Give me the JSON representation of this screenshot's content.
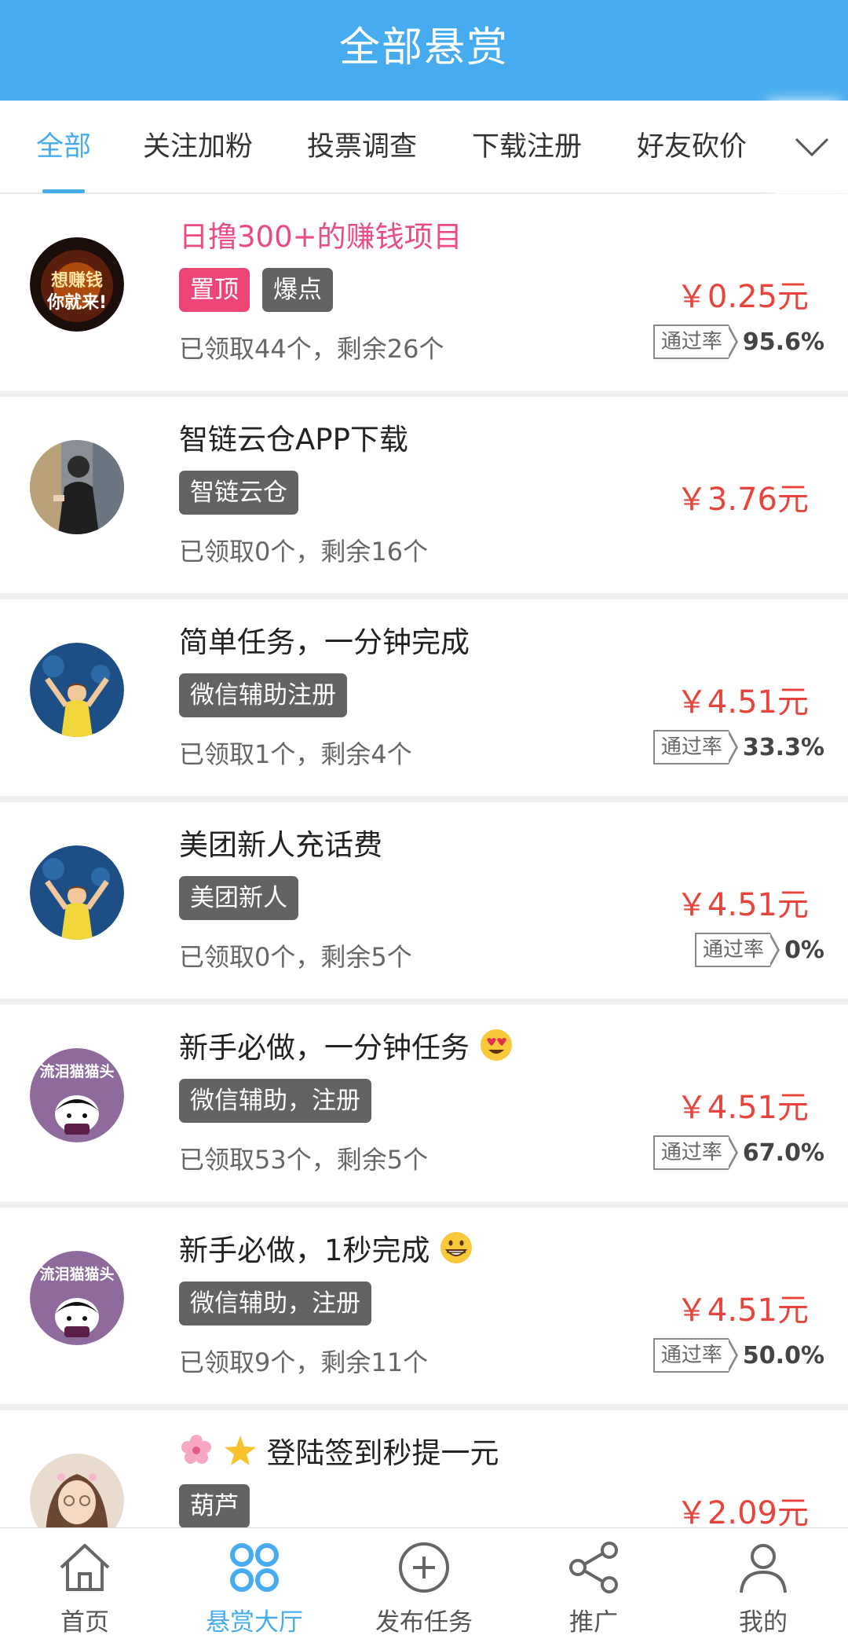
{
  "header": {
    "title": "全部悬赏"
  },
  "tabs": [
    {
      "label": "全部",
      "active": true
    },
    {
      "label": "关注加粉"
    },
    {
      "label": "投票调查"
    },
    {
      "label": "下载注册"
    },
    {
      "label": "好友砍价"
    }
  ],
  "more_icon": "chevron-down-icon",
  "items": [
    {
      "title": "日撸300+的赚钱项目",
      "hot": true,
      "tags": [
        "置顶",
        "爆点"
      ],
      "stats": "已领取44个，剩余26个",
      "price": "￥0.25元",
      "pass_label": "通过率",
      "pass_rate": "95.6%",
      "avatar_text": "想赚钱 你就来!"
    },
    {
      "title": "智链云仓APP下载",
      "tags": [
        "智链云仓"
      ],
      "stats": "已领取0个，剩余16个",
      "price": "￥3.76元"
    },
    {
      "title": "简单任务，一分钟完成",
      "tags": [
        "微信辅助注册"
      ],
      "stats": "已领取1个，剩余4个",
      "price": "￥4.51元",
      "pass_label": "通过率",
      "pass_rate": "33.3%"
    },
    {
      "title": "美团新人充话费",
      "tags": [
        "美团新人"
      ],
      "stats": "已领取0个，剩余5个",
      "price": "￥4.51元",
      "pass_label": "通过率",
      "pass_rate": "0%"
    },
    {
      "title": "新手必做，一分钟任务",
      "emoji": "heart-eyes-emoji",
      "tags": [
        "微信辅助，注册"
      ],
      "stats": "已领取53个，剩余5个",
      "price": "￥4.51元",
      "pass_label": "通过率",
      "pass_rate": "67.0%",
      "avatar_text": "流泪猫猫头"
    },
    {
      "title": "新手必做，1秒完成",
      "emoji": "grin-emoji",
      "tags": [
        "微信辅助，注册"
      ],
      "stats": "已领取9个，剩余11个",
      "price": "￥4.51元",
      "pass_label": "通过率",
      "pass_rate": "50.0%",
      "avatar_text": "流泪猫猫头"
    },
    {
      "title": "登陆签到秒提一元",
      "emoji_prefix": "blossom-star-emoji",
      "tags": [
        "葫芦"
      ],
      "price": "￥2.09元"
    }
  ],
  "bottom_nav": [
    {
      "label": "首页",
      "icon": "home-icon"
    },
    {
      "label": "悬赏大厅",
      "icon": "grid-icon",
      "active": true
    },
    {
      "label": "发布任务",
      "icon": "plus-circle-icon"
    },
    {
      "label": "推广",
      "icon": "share-icon"
    },
    {
      "label": "我的",
      "icon": "user-icon"
    }
  ],
  "colors": {
    "brand": "#47acef",
    "price": "#e8443b",
    "hot_title": "#ea4a86",
    "pink_tag": "#ec4576",
    "tag": "#636363"
  }
}
